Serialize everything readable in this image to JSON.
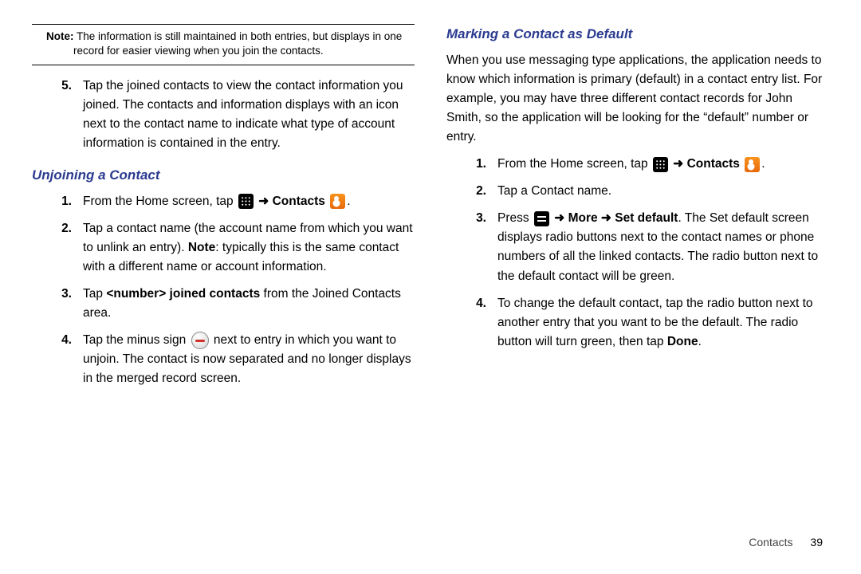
{
  "left": {
    "note_label": "Note:",
    "note_body": "The information is still maintained in both entries, but displays in one record for easier viewing when you join the contacts.",
    "step5_num": "5.",
    "step5": "Tap the joined contacts to view the contact information you joined. The contacts and information displays with an icon next to the contact name to indicate what type of account information is contained in the entry.",
    "heading": "Unjoining a Contact",
    "s1_num": "1.",
    "s1_a": "From the Home screen, tap ",
    "s1_contacts": "Contacts",
    "s1_end": ".",
    "s2_num": "2.",
    "s2_a": "Tap a contact name (the account name from which you want to unlink an entry). ",
    "s2_note": "Note",
    "s2_b": ": typically this is the same contact with a different name or account information.",
    "s3_num": "3.",
    "s3_a": "Tap ",
    "s3_bold": "<number> joined contacts",
    "s3_b": " from the Joined Contacts area.",
    "s4_num": "4.",
    "s4_a": "Tap the minus sign ",
    "s4_b": " next to entry in which you want to unjoin. The contact is now separated and no longer displays in the merged record screen."
  },
  "right": {
    "heading": "Marking a Contact as Default",
    "intro": "When you use messaging type applications, the application needs to know which information is primary (default) in a contact entry list. For example, you may have three different contact records for John Smith, so the application will be looking for the “default” number or entry.",
    "s1_num": "1.",
    "s1_a": "From the Home screen, tap ",
    "s1_contacts": "Contacts",
    "s1_end": ".",
    "s2_num": "2.",
    "s2": "Tap a Contact name.",
    "s3_num": "3.",
    "s3_a": "Press ",
    "s3_more": "More",
    "s3_set": "Set default",
    "s3_b": ". The Set default screen displays radio buttons next to the contact names or phone numbers of all the linked contacts. The radio button next to the default contact will be green.",
    "s4_num": "4.",
    "s4_a": "To change the default contact, tap the radio button next to another entry that you want to be the default. The radio button will turn green, then tap ",
    "s4_done": "Done",
    "s4_end": "."
  },
  "footer": {
    "section": "Contacts",
    "page": "39"
  },
  "glyphs": {
    "arrow": "➜"
  }
}
